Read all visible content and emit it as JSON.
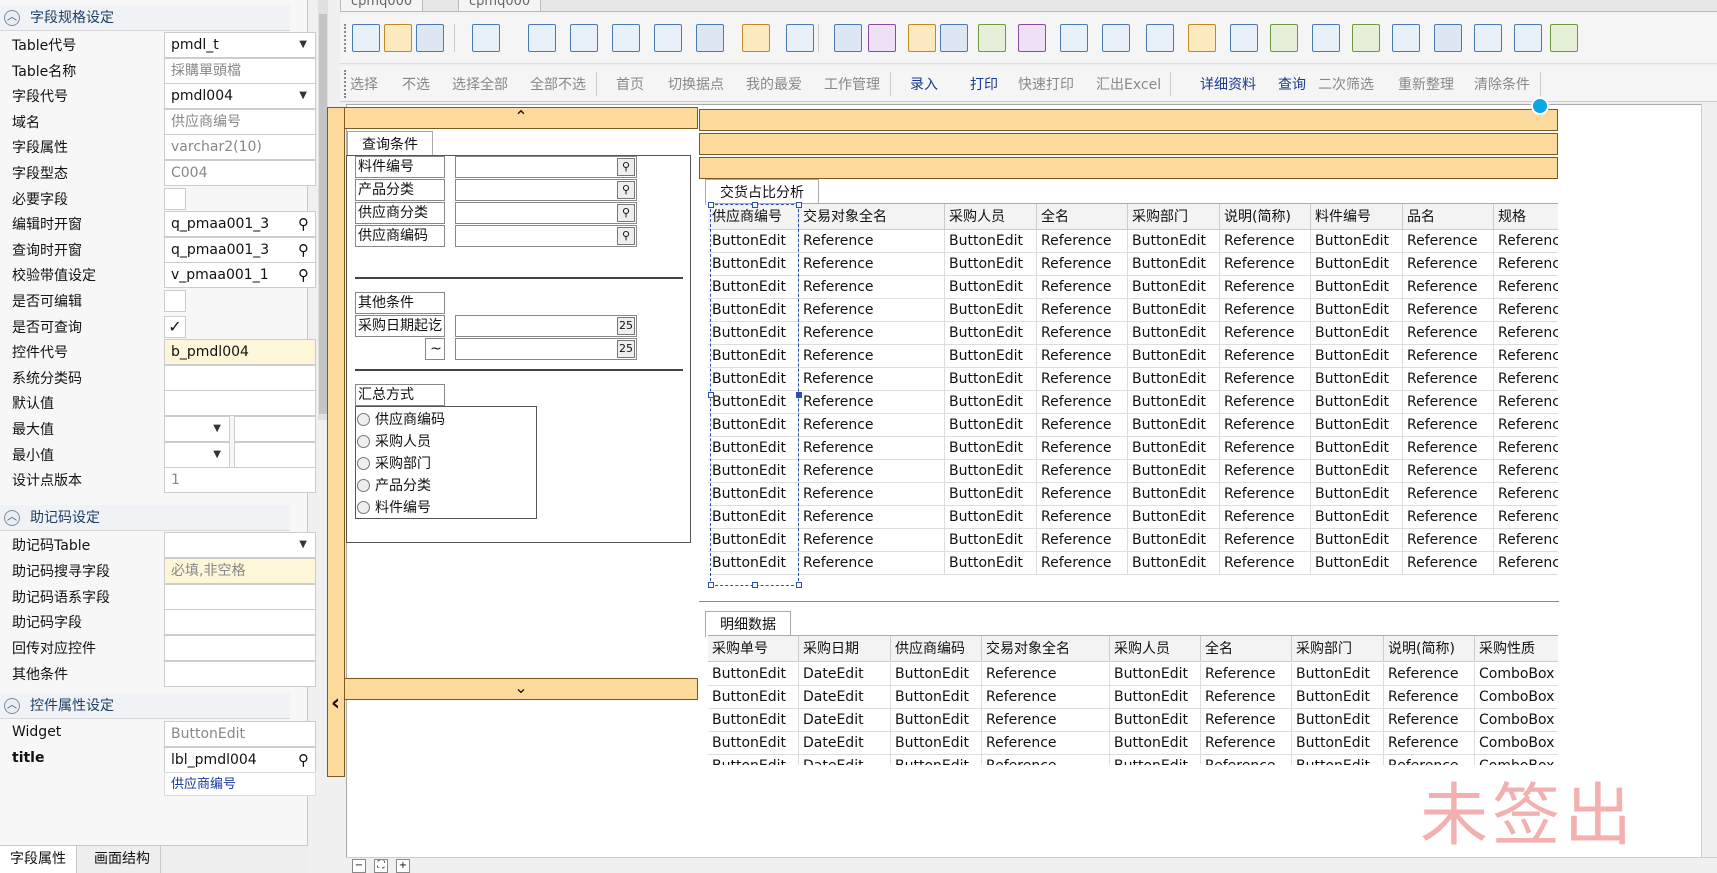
{
  "left_panel": {
    "sections": {
      "field_spec": "字段规格设定",
      "mnemonic": "助记码设定",
      "widget_props": "控件属性设定"
    },
    "props": [
      {
        "label": "Table代号",
        "value": "pmdl_t",
        "kind": "dropdown"
      },
      {
        "label": "Table名称",
        "value": "採購單頭檔",
        "kind": "gray"
      },
      {
        "label": "字段代号",
        "value": "pmdl004",
        "kind": "dropdown"
      },
      {
        "label": "域名",
        "value": "供应商编号",
        "kind": "gray"
      },
      {
        "label": "字段属性",
        "value": "varchar2(10)",
        "kind": "gray"
      },
      {
        "label": "字段型态",
        "value": "C004",
        "kind": "gray"
      },
      {
        "label": "必要字段",
        "value": "",
        "kind": "check"
      },
      {
        "label": "编辑时开窗",
        "value": "q_pmaa001_3",
        "kind": "search"
      },
      {
        "label": "查询时开窗",
        "value": "q_pmaa001_3",
        "kind": "search"
      },
      {
        "label": "校验带值设定",
        "value": "v_pmaa001_1",
        "kind": "search"
      },
      {
        "label": "是否可编辑",
        "value": "",
        "kind": "check"
      },
      {
        "label": "是否可查询",
        "value": "✓",
        "kind": "check"
      },
      {
        "label": "控件代号",
        "value": "b_pmdl004",
        "kind": "yellow"
      },
      {
        "label": "系统分类码",
        "value": "",
        "kind": "text"
      },
      {
        "label": "默认值",
        "value": "",
        "kind": "text"
      },
      {
        "label": "最大值",
        "value": "",
        "kind": "split"
      },
      {
        "label": "最小值",
        "value": "",
        "kind": "split"
      },
      {
        "label": "设计点版本",
        "value": "1",
        "kind": "gray"
      }
    ],
    "mnemonic_props": [
      {
        "label": "助记码Table",
        "value": "",
        "kind": "dropdown"
      },
      {
        "label": "助记码搜寻字段",
        "value": "必填,非空格",
        "kind": "yellowgray"
      },
      {
        "label": "助记码语系字段",
        "value": "",
        "kind": "text"
      },
      {
        "label": "助记码字段",
        "value": "",
        "kind": "text"
      },
      {
        "label": "回传对应控件",
        "value": "",
        "kind": "text"
      },
      {
        "label": "其他条件",
        "value": "",
        "kind": "text"
      }
    ],
    "widget_props": [
      {
        "label": "Widget",
        "value": "ButtonEdit",
        "kind": "gray",
        "bold": false
      },
      {
        "label": "title",
        "value": "lbl_pmdl004",
        "kind": "search",
        "bold": true
      }
    ],
    "title_hint": "供应商编号",
    "bottom_tabs": [
      "字段属性",
      "画面结构"
    ]
  },
  "file_tabs": [
    "cpmq000",
    "cpmq000"
  ],
  "toolbar2": [
    {
      "label": "选择",
      "style": "gray"
    },
    {
      "label": "不选",
      "style": "gray"
    },
    {
      "label": "选择全部",
      "style": "gray"
    },
    {
      "label": "全部不选",
      "style": "gray"
    },
    {
      "label": "首页",
      "style": "gray"
    },
    {
      "label": "切换据点",
      "style": "gray"
    },
    {
      "label": "我的最爱",
      "style": "gray"
    },
    {
      "label": "工作管理",
      "style": "gray"
    },
    {
      "label": "录入",
      "style": "blue"
    },
    {
      "label": "打印",
      "style": "blue"
    },
    {
      "label": "快速打印",
      "style": "gray"
    },
    {
      "label": "汇出Excel",
      "style": "gray"
    },
    {
      "label": "详细资料",
      "style": "blue"
    },
    {
      "label": "查询",
      "style": "blue"
    },
    {
      "label": "二次筛选",
      "style": "gray"
    },
    {
      "label": "重新整理",
      "style": "gray"
    },
    {
      "label": "清除条件",
      "style": "gray"
    }
  ],
  "query": {
    "tab": "查询条件",
    "fields": [
      "料件编号",
      "产品分类",
      "供应商分类",
      "供应商编码"
    ],
    "other_title": "其他条件",
    "date_label": "采购日期起讫",
    "tilde": "~",
    "summary_title": "汇总方式",
    "summary_options": [
      "供应商编码",
      "采购人员",
      "采购部门",
      "产品分类",
      "料件编号"
    ]
  },
  "grid1": {
    "tab": "交货占比分析",
    "columns": [
      "供应商编号",
      "交易对象全名",
      "采购人员",
      "全名",
      "采购部门",
      "说明(简称)",
      "料件编号",
      "品名",
      "规格"
    ],
    "row": [
      "ButtonEdit",
      "Reference",
      "ButtonEdit",
      "Reference",
      "ButtonEdit",
      "Reference",
      "ButtonEdit",
      "Reference",
      "Reference"
    ],
    "row_count": 15
  },
  "grid2": {
    "tab": "明细数据",
    "columns": [
      "采购单号",
      "采购日期",
      "供应商编码",
      "交易对象全名",
      "采购人员",
      "全名",
      "采购部门",
      "说明(简称)",
      "采购性质"
    ],
    "row": [
      "ButtonEdit",
      "DateEdit",
      "ButtonEdit",
      "Reference",
      "ButtonEdit",
      "Reference",
      "ButtonEdit",
      "Reference",
      "ComboBox"
    ],
    "row_count": 5
  },
  "watermark": "未签出"
}
